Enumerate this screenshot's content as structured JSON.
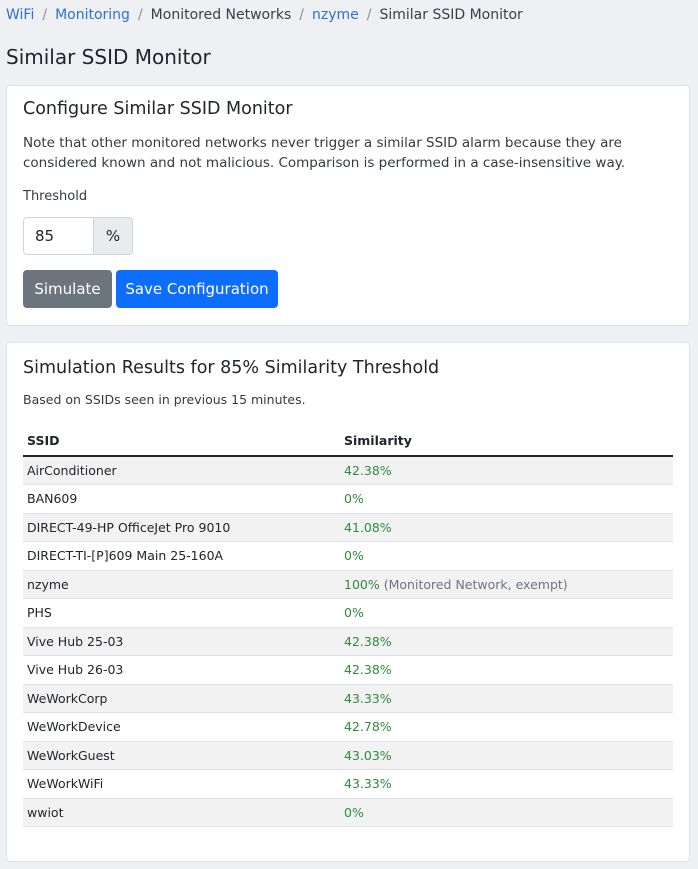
{
  "breadcrumb": {
    "items": [
      {
        "label": "WiFi",
        "link": true
      },
      {
        "label": "Monitoring",
        "link": true
      },
      {
        "label": "Monitored Networks",
        "link": false
      },
      {
        "label": "nzyme",
        "link": true
      },
      {
        "label": "Similar SSID Monitor",
        "link": false
      }
    ],
    "separator": "/"
  },
  "page": {
    "title": "Similar SSID Monitor"
  },
  "config": {
    "title": "Configure Similar SSID Monitor",
    "note": "Note that other monitored networks never trigger a similar SSID alarm because they are considered known and not malicious. Comparison is performed in a case-insensitive way.",
    "threshold_label": "Threshold",
    "threshold_value": "85",
    "threshold_unit": "%",
    "simulate_label": "Simulate",
    "save_label": "Save Configuration"
  },
  "results": {
    "title": "Simulation Results for 85% Similarity Threshold",
    "subtitle": "Based on SSIDs seen in previous 15 minutes.",
    "headers": {
      "ssid": "SSID",
      "similarity": "Similarity"
    },
    "rows": [
      {
        "ssid": "AirConditioner",
        "similarity": "42.38%",
        "note": ""
      },
      {
        "ssid": "BAN609",
        "similarity": "0%",
        "note": ""
      },
      {
        "ssid": "DIRECT-49-HP OfficeJet Pro 9010",
        "similarity": "41.08%",
        "note": ""
      },
      {
        "ssid": "DIRECT-TI-[P]609 Main 25-160A",
        "similarity": "0%",
        "note": ""
      },
      {
        "ssid": "nzyme",
        "similarity": "100%",
        "note": "(Monitored Network, exempt)"
      },
      {
        "ssid": "PHS",
        "similarity": "0%",
        "note": ""
      },
      {
        "ssid": "Vive Hub 25-03",
        "similarity": "42.38%",
        "note": ""
      },
      {
        "ssid": "Vive Hub 26-03",
        "similarity": "42.38%",
        "note": ""
      },
      {
        "ssid": "WeWorkCorp",
        "similarity": "43.33%",
        "note": ""
      },
      {
        "ssid": "WeWorkDevice",
        "similarity": "42.78%",
        "note": ""
      },
      {
        "ssid": "WeWorkGuest",
        "similarity": "43.03%",
        "note": ""
      },
      {
        "ssid": "WeWorkWiFi",
        "similarity": "43.33%",
        "note": ""
      },
      {
        "ssid": "wwiot",
        "similarity": "0%",
        "note": ""
      }
    ]
  },
  "colors": {
    "link": "#2f6fd0",
    "similarity": "#2e8b3e",
    "primary_button": "#0d6efd",
    "secondary_button": "#6c757d"
  }
}
